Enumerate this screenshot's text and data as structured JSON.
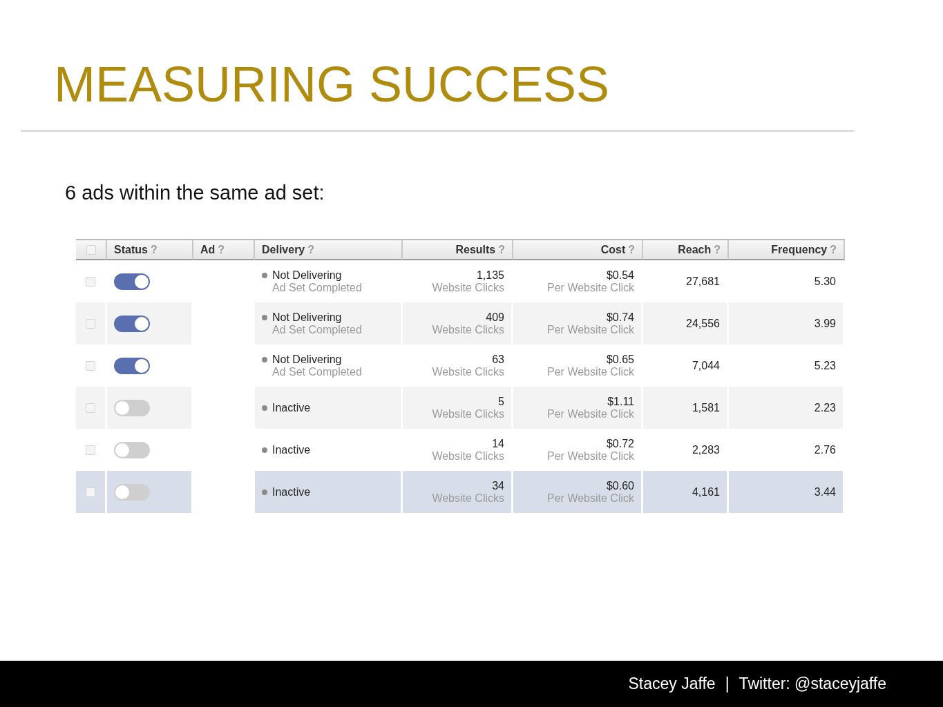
{
  "title": "MEASURING SUCCESS",
  "subtitle": "6 ads within the same ad set:",
  "table": {
    "columns": [
      {
        "kind": "checkbox",
        "checked": false
      },
      {
        "kind": "text",
        "label": "Status",
        "help": "?"
      },
      {
        "kind": "text",
        "label": "Ad",
        "help": "?"
      },
      {
        "kind": "text",
        "label": "Delivery",
        "help": "?"
      },
      {
        "kind": "number",
        "label": "Results",
        "help": "?"
      },
      {
        "kind": "number",
        "label": "Cost",
        "help": "?"
      },
      {
        "kind": "number",
        "label": "Reach",
        "help": "?"
      },
      {
        "kind": "number",
        "label": "Frequency",
        "help": "?"
      }
    ],
    "rows": [
      {
        "selected": false,
        "checked": false,
        "on": true,
        "delivery": "Not Delivering",
        "delivery_detail": "Ad Set Completed",
        "results": "1,135",
        "results_label": "Website Clicks",
        "cost": "$0.54",
        "cost_label": "Per Website Click",
        "reach": "27,681",
        "frequency": "5.30"
      },
      {
        "selected": false,
        "checked": false,
        "on": true,
        "delivery": "Not Delivering",
        "delivery_detail": "Ad Set Completed",
        "results": "409",
        "results_label": "Website Clicks",
        "cost": "$0.74",
        "cost_label": "Per Website Click",
        "reach": "24,556",
        "frequency": "3.99"
      },
      {
        "selected": false,
        "checked": false,
        "on": true,
        "delivery": "Not Delivering",
        "delivery_detail": "Ad Set Completed",
        "results": "63",
        "results_label": "Website Clicks",
        "cost": "$0.65",
        "cost_label": "Per Website Click",
        "reach": "7,044",
        "frequency": "5.23"
      },
      {
        "selected": false,
        "checked": false,
        "on": false,
        "delivery": "Inactive",
        "results": "5",
        "results_label": "Website Clicks",
        "cost": "$1.11",
        "cost_label": "Per Website Click",
        "reach": "1,581",
        "frequency": "2.23"
      },
      {
        "selected": false,
        "checked": false,
        "on": false,
        "delivery": "Inactive",
        "results": "14",
        "results_label": "Website Clicks",
        "cost": "$0.72",
        "cost_label": "Per Website Click",
        "reach": "2,283",
        "frequency": "2.76"
      },
      {
        "selected": true,
        "checked": false,
        "on": false,
        "delivery": "Inactive",
        "results": "34",
        "results_label": "Website Clicks",
        "cost": "$0.60",
        "cost_label": "Per Website Click",
        "reach": "4,161",
        "frequency": "3.44"
      }
    ]
  },
  "footer": {
    "author": "Stacey Jaffe",
    "separator": "|",
    "twitter": "Twitter: @staceyjaffe"
  }
}
